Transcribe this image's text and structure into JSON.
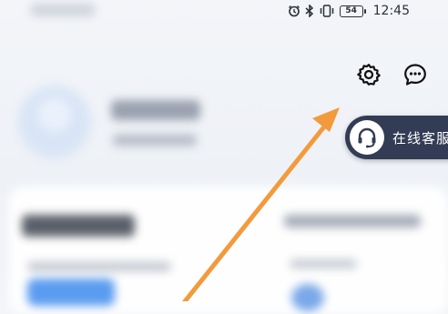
{
  "status_bar": {
    "time": "12:45",
    "battery": "54",
    "icons": [
      "alarm-icon",
      "bluetooth-icon",
      "vibrate-icon",
      "battery-icon"
    ]
  },
  "header": {
    "settings_icon": "gear-icon",
    "messages_icon": "chat-bubble-icon"
  },
  "service": {
    "label": "在线客服",
    "icon": "headset-icon",
    "colors": {
      "pill": "#333c55",
      "text": "#ffffff"
    }
  },
  "annotation": {
    "arrow_color": "#f39a3c",
    "points_to": "settings-button"
  },
  "accent": {
    "blue": "#5a9cf0"
  }
}
